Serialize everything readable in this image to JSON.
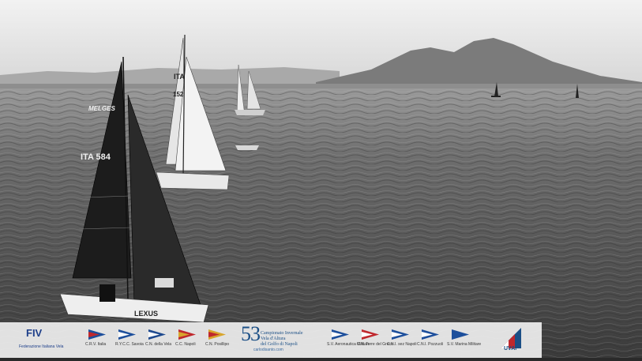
{
  "photo": {
    "sail_number": "ITA 584",
    "sail_brand": "MELGES",
    "hull_brand": "LEXUS",
    "second_sail_number": "ITA 152"
  },
  "sponsors": {
    "fiv": {
      "logo": "FIV",
      "label": "Federazione Italiana Vela"
    },
    "clubs": [
      {
        "label": "C.R.V. Italia",
        "color1": "#c0282d",
        "color2": "#1d4f9c"
      },
      {
        "label": "R.Y.C.C. Savoia",
        "color1": "#ffffff",
        "color2": "#1d4f9c"
      },
      {
        "label": "C.N. della Vela",
        "color1": "#ffffff",
        "color2": "#1f4a8f"
      },
      {
        "label": "C.C. Napoli",
        "color1": "#d8a52c",
        "color2": "#c0282d"
      },
      {
        "label": "C.N. Posillipo",
        "color1": "#c0282d",
        "color2": "#d8a52c"
      }
    ],
    "event": {
      "number": "53",
      "line1": "Campionato Invernale",
      "line2": "Vela d'Altura",
      "line3": "del Golfo di Napoli",
      "site": "carlodisanto.com"
    },
    "clubs_right": [
      {
        "label": "S.V. Aeronautica Militare",
        "color1": "#ffffff",
        "color2": "#1d4f9c"
      },
      {
        "label": "C.N. Torre del Greco",
        "color1": "#ffffff",
        "color2": "#c0282d"
      },
      {
        "label": "C.N.I. sez Napoli",
        "color1": "#ffffff",
        "color2": "#1d4f9c"
      },
      {
        "label": "C.N.I. Pozzuoli",
        "color1": "#ffffff",
        "color2": "#1d4f9c"
      },
      {
        "label": "S.V. Marina Militare",
        "color1": "#1d4f9c",
        "color2": "#1d4f9c"
      }
    ],
    "uvai": {
      "label": "UVAI"
    }
  }
}
